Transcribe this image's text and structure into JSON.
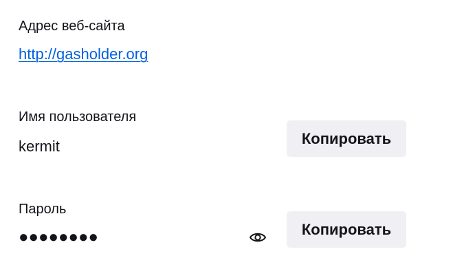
{
  "website": {
    "label": "Адрес веб-сайта",
    "url": "http://gasholder.org"
  },
  "username": {
    "label": "Имя пользователя",
    "value": "kermit",
    "copy_label": "Копировать"
  },
  "password": {
    "label": "Пароль",
    "masked_value": "●●●●●●●●",
    "copy_label": "Копировать",
    "reveal_icon": "eye-icon"
  },
  "colors": {
    "link": "#0061e0",
    "button_bg": "#f0f0f4",
    "text": "#15141a"
  }
}
